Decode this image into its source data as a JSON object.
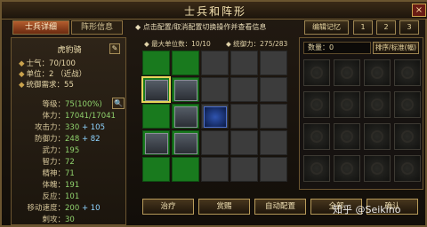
{
  "window": {
    "title": "士兵和阵形",
    "close_label": "×"
  },
  "tabs": [
    {
      "label": "士兵详细"
    },
    {
      "label": "阵形信息"
    }
  ],
  "hint": "◆ 点击配置/取消配置切换操作并查看信息",
  "toolbar": {
    "edit_memory": "编辑记忆",
    "memory_slots": [
      "1",
      "2",
      "3"
    ]
  },
  "unit": {
    "name": "虎豹骑",
    "edit_icon": "pencil-icon",
    "morale": "士气：70/100",
    "unit_count": "单位：2",
    "unit_type": "（近战）",
    "command_needed": "统御需求：55",
    "stats": [
      {
        "k": "等级：",
        "v": "75(100%)"
      },
      {
        "k": "体力：",
        "v": "17041/17041"
      },
      {
        "k": "攻击力：",
        "v": "330",
        "bonus": "+ 105"
      },
      {
        "k": "防御力：",
        "v": "248",
        "bonus": "+ 82"
      },
      {
        "k": "武力：",
        "v": "195"
      },
      {
        "k": "智力：",
        "v": "72"
      },
      {
        "k": "精神：",
        "v": "71"
      },
      {
        "k": "体魄：",
        "v": "191"
      },
      {
        "k": "反应：",
        "v": "101"
      },
      {
        "k": "移动速度：",
        "v": "200",
        "bonus": "+ 10"
      },
      {
        "k": "刺攻：",
        "v": "30"
      }
    ]
  },
  "formation": {
    "max_units": "◆ 最大单位数：10/10",
    "command": "◆ 统御力：275/283"
  },
  "reserve": {
    "count": "数量：0",
    "sort_label": "排序/标准(幅)"
  },
  "actions": [
    {
      "label": "治疗"
    },
    {
      "label": "赏赐"
    },
    {
      "label": "自动配置"
    },
    {
      "label": "全部"
    },
    {
      "label": "确认"
    }
  ],
  "watermark": "知乎 @Seikino"
}
